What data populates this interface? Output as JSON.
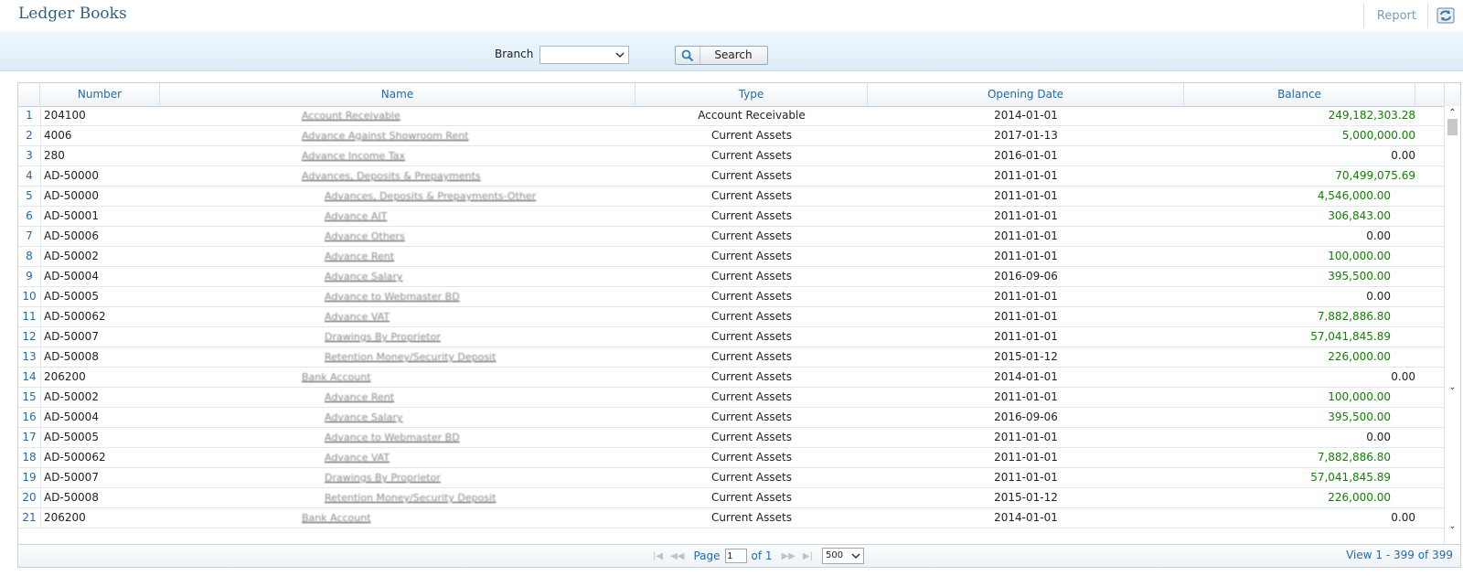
{
  "header": {
    "title": "Ledger Books",
    "report_label": "Report",
    "refresh_icon": "refresh-icon"
  },
  "filter": {
    "branch_label": "Branch",
    "branch_value": "",
    "search_label": "Search"
  },
  "grid": {
    "columns": [
      "Number",
      "Name",
      "Type",
      "Opening Date",
      "Balance"
    ],
    "rows": [
      {
        "idx": "1",
        "number": "204100",
        "name": "Account Receivable",
        "type": "Account Receivable",
        "date": "2014-01-01",
        "balance": "249,182,303.28",
        "level": 0
      },
      {
        "idx": "2",
        "number": "4006",
        "name": "Advance Against Showroom Rent",
        "type": "Current Assets",
        "date": "2017-01-13",
        "balance": "5,000,000.00",
        "level": 0
      },
      {
        "idx": "3",
        "number": "280",
        "name": "Advance Income Tax",
        "type": "Current Assets",
        "date": "2016-01-01",
        "balance": "0.00",
        "level": 0
      },
      {
        "idx": "4",
        "number": "AD-50000",
        "name": "Advances, Deposits & Prepayments",
        "type": "Current Assets",
        "date": "2011-01-01",
        "balance": "70,499,075.69",
        "level": 0
      },
      {
        "idx": "5",
        "number": "AD-50000",
        "name": "Advances, Deposits & Prepayments-Other",
        "type": "Current Assets",
        "date": "2011-01-01",
        "balance": "4,546,000.00",
        "level": 1
      },
      {
        "idx": "6",
        "number": "AD-50001",
        "name": "Advance AIT",
        "type": "Current Assets",
        "date": "2011-01-01",
        "balance": "306,843.00",
        "level": 1
      },
      {
        "idx": "7",
        "number": "AD-50006",
        "name": "Advance Others",
        "type": "Current Assets",
        "date": "2011-01-01",
        "balance": "0.00",
        "level": 1
      },
      {
        "idx": "8",
        "number": "AD-50002",
        "name": "Advance Rent",
        "type": "Current Assets",
        "date": "2011-01-01",
        "balance": "100,000.00",
        "level": 1
      },
      {
        "idx": "9",
        "number": "AD-50004",
        "name": "Advance Salary",
        "type": "Current Assets",
        "date": "2016-09-06",
        "balance": "395,500.00",
        "level": 1
      },
      {
        "idx": "10",
        "number": "AD-50005",
        "name": "Advance to Webmaster BD",
        "type": "Current Assets",
        "date": "2011-01-01",
        "balance": "0.00",
        "level": 1
      },
      {
        "idx": "11",
        "number": "AD-500062",
        "name": "Advance VAT",
        "type": "Current Assets",
        "date": "2011-01-01",
        "balance": "7,882,886.80",
        "level": 1
      },
      {
        "idx": "12",
        "number": "AD-50007",
        "name": "Drawings By Proprietor",
        "type": "Current Assets",
        "date": "2011-01-01",
        "balance": "57,041,845.89",
        "level": 1
      },
      {
        "idx": "13",
        "number": "AD-50008",
        "name": "Retention Money/Security Deposit",
        "type": "Current Assets",
        "date": "2015-01-12",
        "balance": "226,000.00",
        "level": 1
      },
      {
        "idx": "14",
        "number": "206200",
        "name": "Bank Account",
        "type": "Current Assets",
        "date": "2014-01-01",
        "balance": "0.00",
        "level": 0
      },
      {
        "idx": "15",
        "number": "AD-50002",
        "name": "Advance Rent",
        "type": "Current Assets",
        "date": "2011-01-01",
        "balance": "100,000.00",
        "level": 1
      },
      {
        "idx": "16",
        "number": "AD-50004",
        "name": "Advance Salary",
        "type": "Current Assets",
        "date": "2016-09-06",
        "balance": "395,500.00",
        "level": 1
      },
      {
        "idx": "17",
        "number": "AD-50005",
        "name": "Advance to Webmaster BD",
        "type": "Current Assets",
        "date": "2011-01-01",
        "balance": "0.00",
        "level": 1
      },
      {
        "idx": "18",
        "number": "AD-500062",
        "name": "Advance VAT",
        "type": "Current Assets",
        "date": "2011-01-01",
        "balance": "7,882,886.80",
        "level": 1
      },
      {
        "idx": "19",
        "number": "AD-50007",
        "name": "Drawings By Proprietor",
        "type": "Current Assets",
        "date": "2011-01-01",
        "balance": "57,041,845.89",
        "level": 1
      },
      {
        "idx": "20",
        "number": "AD-50008",
        "name": "Retention Money/Security Deposit",
        "type": "Current Assets",
        "date": "2015-01-12",
        "balance": "226,000.00",
        "level": 1
      },
      {
        "idx": "21",
        "number": "206200",
        "name": "Bank Account",
        "type": "Current Assets",
        "date": "2014-01-01",
        "balance": "0.00",
        "level": 0
      }
    ]
  },
  "pager": {
    "page_label": "Page",
    "page_value": "1",
    "of_label": "of 1",
    "page_size": "500",
    "view_info": "View 1 - 399 of 399"
  },
  "colors": {
    "accent": "#1d6bb0",
    "positive_balance": "#108000",
    "title": "#2f5f86"
  }
}
